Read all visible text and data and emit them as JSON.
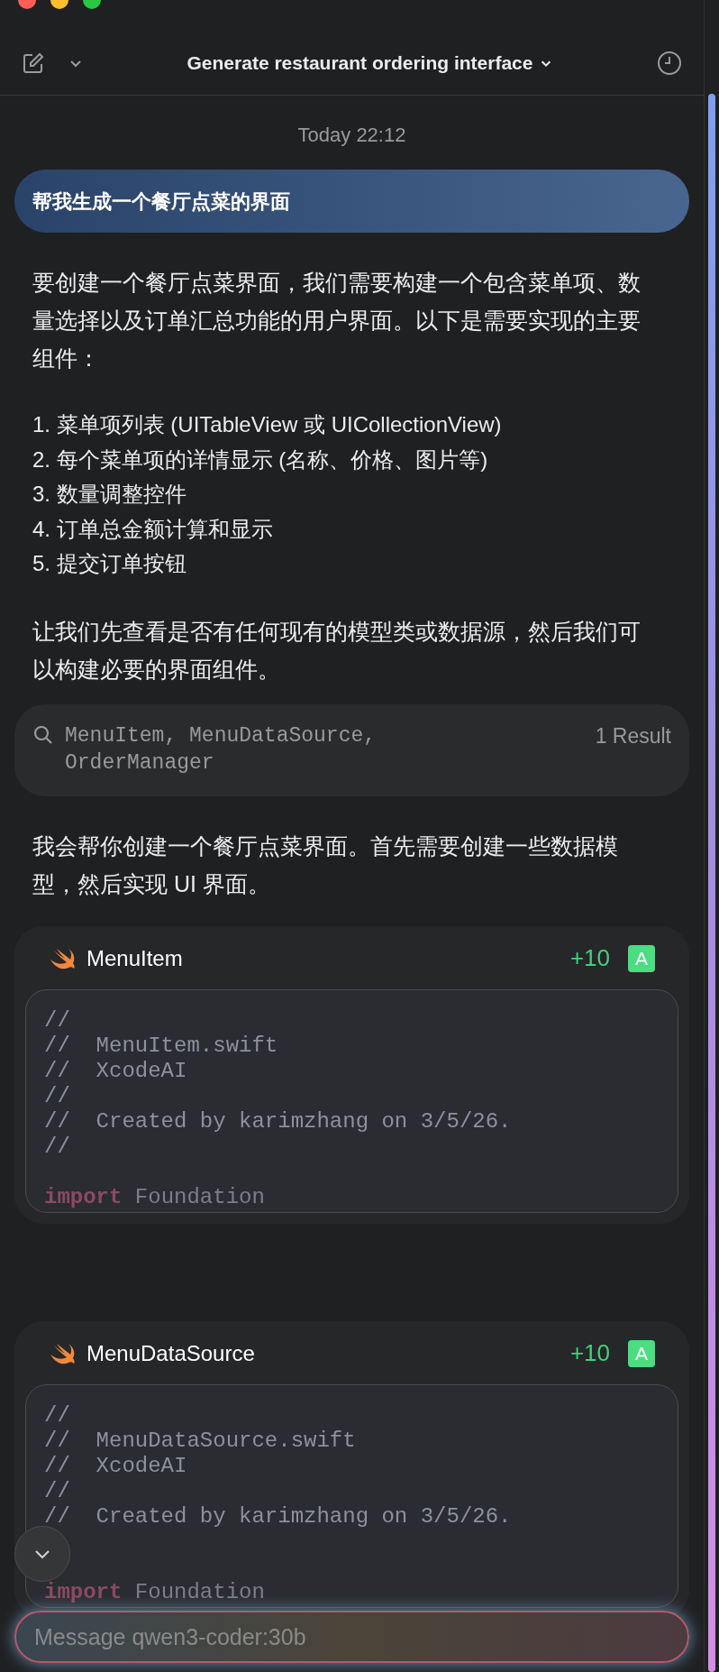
{
  "header": {
    "title": "Generate restaurant ordering interface"
  },
  "timestamp": "Today 22:12",
  "blocks": [
    {
      "kind": "user",
      "text": "帮我生成一个餐厅点菜的界面"
    },
    {
      "kind": "paragraph",
      "text": "要创建一个餐厅点菜界面，我们需要构建一个包含菜单项、数量选择以及订单汇总功能的用户界面。以下是需要实现的主要组件："
    },
    {
      "kind": "list",
      "items": [
        "1. 菜单项列表 (UITableView 或 UICollectionView)",
        "2. 每个菜单项的详情显示 (名称、价格、图片等)",
        "3. 数量调整控件",
        "4. 订单总金额计算和显示",
        "5. 提交订单按钮"
      ]
    },
    {
      "kind": "paragraph",
      "text": "让我们先查看是否有任何现有的模型类或数据源，然后我们可以构建必要的界面组件。"
    },
    {
      "kind": "search",
      "query": "MenuItem, MenuDataSource, OrderManager",
      "result": "1 Result"
    },
    {
      "kind": "paragraph",
      "text": "我会帮你创建一个餐厅点菜界面。首先需要创建一些数据模型，然后实现 UI 界面。"
    },
    {
      "kind": "file",
      "name": "MenuItem",
      "added": "+10",
      "badge": "A",
      "lines": [
        {
          "kind": "comment",
          "text": "//"
        },
        {
          "kind": "comment",
          "text": "//  MenuItem.swift"
        },
        {
          "kind": "comment",
          "text": "//  XcodeAI"
        },
        {
          "kind": "comment",
          "text": "//"
        },
        {
          "kind": "comment",
          "text": "//  Created by karimzhang on 3/5/26."
        },
        {
          "kind": "comment",
          "text": "//"
        },
        {
          "kind": "blank"
        },
        {
          "kind": "import",
          "keyword": "import",
          "text": "Foundation"
        }
      ]
    },
    {
      "kind": "file",
      "name": "MenuDataSource",
      "added": "+10",
      "badge": "A",
      "lines": [
        {
          "kind": "comment",
          "text": "//"
        },
        {
          "kind": "comment",
          "text": "//  MenuDataSource.swift"
        },
        {
          "kind": "comment",
          "text": "//  XcodeAI"
        },
        {
          "kind": "comment",
          "text": "//"
        },
        {
          "kind": "comment",
          "text": "//  Created by karimzhang on 3/5/26."
        },
        {
          "kind": "blank"
        },
        {
          "kind": "blank"
        },
        {
          "kind": "import",
          "keyword": "import",
          "text": "Foundation"
        }
      ]
    }
  ],
  "composer": {
    "placeholder": "Message qwen3-coder:30b"
  }
}
